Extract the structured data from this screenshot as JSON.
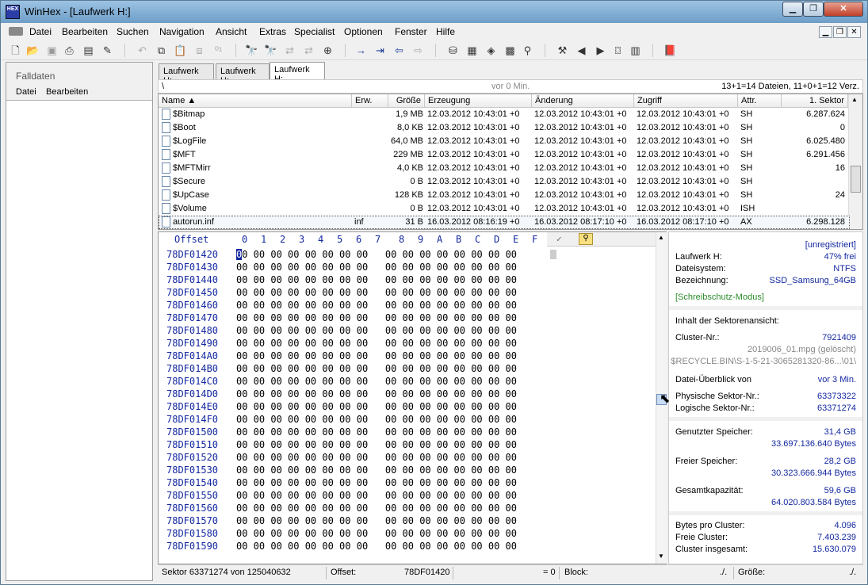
{
  "window": {
    "title": "WinHex - [Laufwerk H:]",
    "app_icon_text": "HEX"
  },
  "menu": [
    "Datei",
    "Bearbeiten",
    "Suchen",
    "Navigation",
    "Ansicht",
    "Extras",
    "Specialist",
    "Optionen",
    "Fenster",
    "Hilfe"
  ],
  "left_panel": {
    "title": "Falldaten",
    "menu": [
      "Datei",
      "Bearbeiten"
    ]
  },
  "tabs": [
    "Laufwerk H:",
    "Laufwerk H:",
    "Laufwerk H:"
  ],
  "path_bar": {
    "path": "\\",
    "age": "vor 0 Min.",
    "counts": "13+1=14 Dateien, 11+0+1=12 Verz."
  },
  "file_columns": [
    "Name ▲",
    "Erw.",
    "Größe",
    "Erzeugung",
    "Änderung",
    "Zugriff",
    "Attr.",
    "1. Sektor"
  ],
  "files": [
    {
      "name": "$Bitmap",
      "ext": "",
      "size": "1,9 MB",
      "created": "12.03.2012  10:43:01  +0",
      "modified": "12.03.2012  10:43:01  +0",
      "accessed": "12.03.2012  10:43:01  +0",
      "attr": "SH",
      "sector": "6.287.624"
    },
    {
      "name": "$Boot",
      "ext": "",
      "size": "8,0 KB",
      "created": "12.03.2012  10:43:01  +0",
      "modified": "12.03.2012  10:43:01  +0",
      "accessed": "12.03.2012  10:43:01  +0",
      "attr": "SH",
      "sector": "0"
    },
    {
      "name": "$LogFile",
      "ext": "",
      "size": "64,0 MB",
      "created": "12.03.2012  10:43:01  +0",
      "modified": "12.03.2012  10:43:01  +0",
      "accessed": "12.03.2012  10:43:01  +0",
      "attr": "SH",
      "sector": "6.025.480"
    },
    {
      "name": "$MFT",
      "ext": "",
      "size": "229 MB",
      "created": "12.03.2012  10:43:01  +0",
      "modified": "12.03.2012  10:43:01  +0",
      "accessed": "12.03.2012  10:43:01  +0",
      "attr": "SH",
      "sector": "6.291.456"
    },
    {
      "name": "$MFTMirr",
      "ext": "",
      "size": "4,0 KB",
      "created": "12.03.2012  10:43:01  +0",
      "modified": "12.03.2012  10:43:01  +0",
      "accessed": "12.03.2012  10:43:01  +0",
      "attr": "SH",
      "sector": "16"
    },
    {
      "name": "$Secure",
      "ext": "",
      "size": "0 B",
      "created": "12.03.2012  10:43:01  +0",
      "modified": "12.03.2012  10:43:01  +0",
      "accessed": "12.03.2012  10:43:01  +0",
      "attr": "SH",
      "sector": ""
    },
    {
      "name": "$UpCase",
      "ext": "",
      "size": "128 KB",
      "created": "12.03.2012  10:43:01  +0",
      "modified": "12.03.2012  10:43:01  +0",
      "accessed": "12.03.2012  10:43:01  +0",
      "attr": "SH",
      "sector": "24"
    },
    {
      "name": "$Volume",
      "ext": "",
      "size": "0 B",
      "created": "12.03.2012  10:43:01  +0",
      "modified": "12.03.2012  10:43:01  +0",
      "accessed": "12.03.2012  10:43:01  +0",
      "attr": "ISH",
      "sector": ""
    },
    {
      "name": "autorun.inf",
      "ext": "inf",
      "size": "31 B",
      "created": "16.03.2012  08:16:19  +0",
      "modified": "16.03.2012  08:17:10  +0",
      "accessed": "16.03.2012  08:17:10  +0",
      "attr": "AX",
      "sector": "6.298.128"
    }
  ],
  "hex": {
    "offset_label": "Offset",
    "column_labels": [
      "0",
      "1",
      "2",
      "3",
      "4",
      "5",
      "6",
      "7",
      "8",
      "9",
      "A",
      "B",
      "C",
      "D",
      "E",
      "F"
    ],
    "offsets": [
      "78DF01420",
      "78DF01430",
      "78DF01440",
      "78DF01450",
      "78DF01460",
      "78DF01470",
      "78DF01480",
      "78DF01490",
      "78DF014A0",
      "78DF014B0",
      "78DF014C0",
      "78DF014D0",
      "78DF014E0",
      "78DF014F0",
      "78DF01500",
      "78DF01510",
      "78DF01520",
      "78DF01530",
      "78DF01540",
      "78DF01550",
      "78DF01560",
      "78DF01570",
      "78DF01580",
      "78DF01590"
    ],
    "row_bytes": "00 00 00 00 00 00 00 00   00 00 00 00 00 00 00 00"
  },
  "info": {
    "unregistered": "[unregistriert]",
    "drive_label": "Laufwerk H:",
    "drive_free": "47% frei",
    "fs_label": "Dateisystem:",
    "fs_value": "NTFS",
    "name_label": "Bezeichnung:",
    "name_value": "SSD_Samsung_64GB",
    "write_protect": "[Schreibschutz-Modus]",
    "sector_view": "Inhalt der Sektorenansicht:",
    "cluster_label": "Cluster-Nr.:",
    "cluster_value": "7921409",
    "file_name": "2019006_01.mpg (gelöscht)",
    "file_path": "$RECYCLE.BIN\\S-1-5-21-3065281320-86...\\01\\",
    "overview_label": "Datei-Überblick von",
    "overview_value": "vor 3 Min.",
    "phys_label": "Physische Sektor-Nr.:",
    "phys_value": "63373322",
    "log_label": "Logische Sektor-Nr.:",
    "log_value": "63371274",
    "used_label": "Genutzter Speicher:",
    "used_gb": "31,4 GB",
    "used_bytes": "33.697.136.640 Bytes",
    "free_label": "Freier Speicher:",
    "free_gb": "28,2 GB",
    "free_bytes": "30.323.666.944 Bytes",
    "total_label": "Gesamtkapazität:",
    "total_gb": "59,6 GB",
    "total_bytes": "64.020.803.584 Bytes",
    "bpc_label": "Bytes pro Cluster:",
    "bpc_value": "4.096",
    "fc_label": "Freie Cluster:",
    "fc_value": "7.403.239",
    "tc_label": "Cluster insgesamt:",
    "tc_value": "15.630.079"
  },
  "status": {
    "sector": "Sektor 63371274 von 125040632",
    "offset_label": "Offset:",
    "offset_value": "78DF01420",
    "value": "= 0",
    "block_label": "Block:",
    "block_value": "./.",
    "size_label": "Größe:",
    "size_value": "./."
  }
}
